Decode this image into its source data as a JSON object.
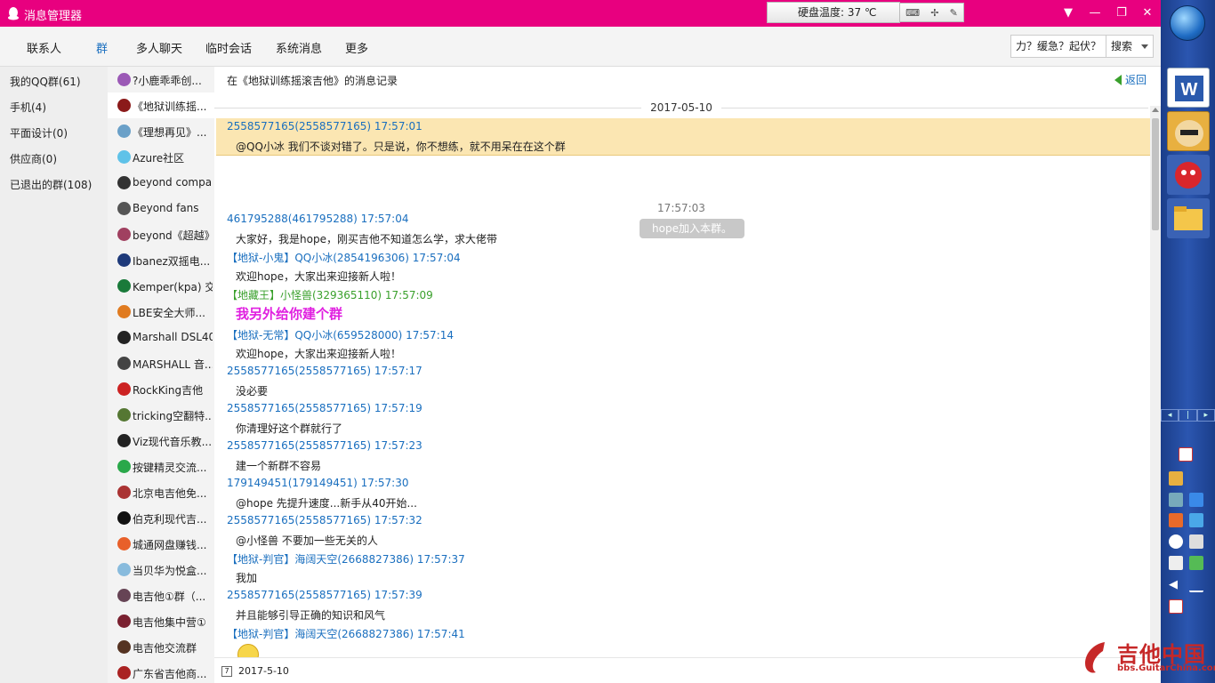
{
  "window": {
    "title": "消息管理器",
    "hdd_temp": "硬盘温度: 37 ℃"
  },
  "tabs": [
    {
      "label": "联系人"
    },
    {
      "label": "群"
    },
    {
      "label": "多人聊天"
    },
    {
      "label": "临时会话"
    },
    {
      "label": "系统消息"
    },
    {
      "label": "更多"
    }
  ],
  "search": {
    "value": "力？缓急？起伏？",
    "button": "搜索"
  },
  "categories": [
    {
      "label": "我的QQ群(61)"
    },
    {
      "label": "手机(4)"
    },
    {
      "label": "平面设计(0)"
    },
    {
      "label": "供应商(0)"
    },
    {
      "label": "已退出的群(108)"
    }
  ],
  "groups": [
    {
      "name": "?小鹿乖乖创...",
      "color": "#9b59b6"
    },
    {
      "name": "《地狱训练摇...",
      "color": "#8b1a1a"
    },
    {
      "name": "《理想再见》...",
      "color": "#6aa0c8"
    },
    {
      "name": "Azure社区",
      "color": "#5fc2e8"
    },
    {
      "name": "beyond compare",
      "color": "#333333"
    },
    {
      "name": "Beyond fans",
      "color": "#555555"
    },
    {
      "name": "beyond《超越》",
      "color": "#a04060"
    },
    {
      "name": "Ibanez双摇电...",
      "color": "#1e3a7a"
    },
    {
      "name": "Kemper(kpa) 交流",
      "color": "#1a7a3a"
    },
    {
      "name": "LBE安全大师...",
      "color": "#e07b20"
    },
    {
      "name": "Marshall DSL40C",
      "color": "#222222"
    },
    {
      "name": "MARSHALL 音...",
      "color": "#444444"
    },
    {
      "name": "RockKing吉他",
      "color": "#cc2222"
    },
    {
      "name": "tricking空翻特...",
      "color": "#557733"
    },
    {
      "name": "Viz现代音乐教...",
      "color": "#222222"
    },
    {
      "name": "按键精灵交流...",
      "color": "#2aa84a"
    },
    {
      "name": "北京电吉他免...",
      "color": "#aa3333"
    },
    {
      "name": "伯克利现代吉...",
      "color": "#111111"
    },
    {
      "name": "城通网盘赚钱...",
      "color": "#e8602a"
    },
    {
      "name": "当贝华为悦盒...",
      "color": "#88bbdd"
    },
    {
      "name": "电吉他①群（...",
      "color": "#664455"
    },
    {
      "name": "电吉他集中营①",
      "color": "#7a2030"
    },
    {
      "name": "电吉他交流群",
      "color": "#553322"
    },
    {
      "name": "广东省吉他商...",
      "color": "#aa2222"
    }
  ],
  "main": {
    "record_title": "在《地狱训练摇滚吉他》的消息记录",
    "back_label": "返回",
    "date": "2017-05-10",
    "bottom_date": "2017-5-10"
  },
  "messages": [
    {
      "header": "2558577165(2558577165) 17:57:01",
      "body": "@QQ小冰 我们不谈对错了。只是说，你不想练，就不用呆在在这个群",
      "highlight": true
    },
    {
      "system_time": "17:57:03",
      "system_text": "hope加入本群。"
    },
    {
      "header": "461795288(461795288) 17:57:04",
      "body": "大家好，我是hope，刚买吉他不知道怎么学，求大佬带"
    },
    {
      "header": "【地狱-小鬼】QQ小冰(2854196306) 17:57:04",
      "body": "欢迎hope，大家出来迎接新人啦！"
    },
    {
      "header": "【地藏王】小怪兽(329365110) 17:57:09",
      "body": "我另外给你建个群",
      "green": true,
      "big": true
    },
    {
      "header": "【地狱-无常】QQ小冰(659528000) 17:57:14",
      "body": "欢迎hope，大家出来迎接新人啦！"
    },
    {
      "header": "2558577165(2558577165) 17:57:17",
      "body": "没必要"
    },
    {
      "header": "2558577165(2558577165) 17:57:19",
      "body": "你清理好这个群就行了"
    },
    {
      "header": "2558577165(2558577165) 17:57:23",
      "body": "建一个新群不容易"
    },
    {
      "header": "179149451(179149451) 17:57:30",
      "body": "@hope 先提升速度...新手从40开始..."
    },
    {
      "header": "2558577165(2558577165) 17:57:32",
      "body": "@小怪兽 不要加一些无关的人"
    },
    {
      "header": "【地狱-判官】海阔天空(2668827386) 17:57:37",
      "body": "我加"
    },
    {
      "header": "2558577165(2558577165) 17:57:39",
      "body": "并且能够引导正确的知识和风气"
    },
    {
      "header": "【地狱-判官】海阔天空(2668827386) 17:57:41",
      "body": ""
    }
  ],
  "watermark": {
    "title": "吉他中国",
    "url": "bbs.GuitarChina.com"
  },
  "colors": {
    "titlebar": "#e8007f",
    "link": "#1a6fbf",
    "highlight": "#fbe6b2",
    "accent_pink": "#e020e0"
  }
}
